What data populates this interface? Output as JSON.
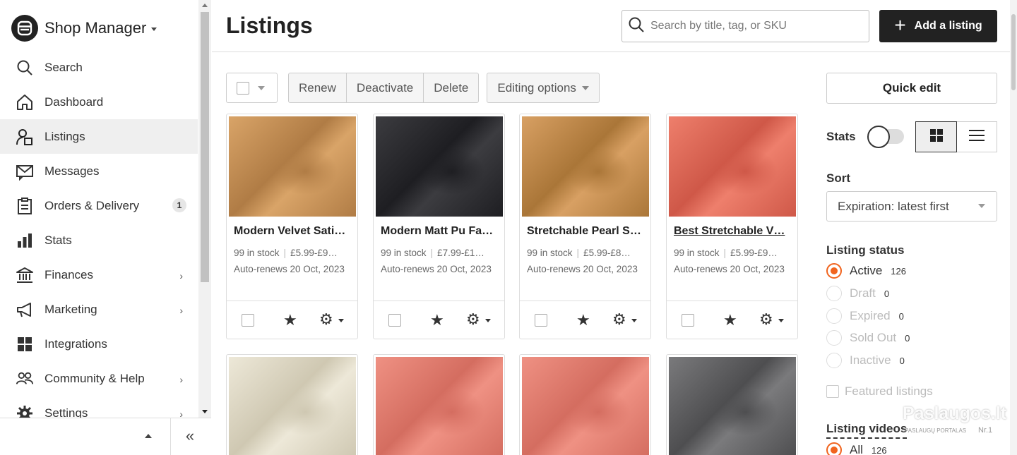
{
  "sidebar": {
    "shop_title": "Shop Manager",
    "items": [
      {
        "label": "Search",
        "icon": "search-icon"
      },
      {
        "label": "Dashboard",
        "icon": "home-icon"
      },
      {
        "label": "Listings",
        "icon": "listings-icon",
        "active": true
      },
      {
        "label": "Messages",
        "icon": "envelope-icon"
      },
      {
        "label": "Orders & Delivery",
        "icon": "clipboard-icon",
        "badge": "1"
      },
      {
        "label": "Stats",
        "icon": "bar-chart-icon"
      },
      {
        "label": "Finances",
        "icon": "bank-icon",
        "has_submenu": true
      },
      {
        "label": "Marketing",
        "icon": "megaphone-icon",
        "has_submenu": true
      },
      {
        "label": "Integrations",
        "icon": "grid-icon"
      },
      {
        "label": "Community & Help",
        "icon": "people-icon",
        "has_submenu": true
      },
      {
        "label": "Settings",
        "icon": "gear-icon",
        "has_submenu": true
      }
    ],
    "collapse_glyph": "«"
  },
  "header": {
    "title": "Listings",
    "search_placeholder": "Search by title, tag, or SKU",
    "add_button": "Add a listing",
    "add_glyph": "+"
  },
  "toolbar": {
    "renew": "Renew",
    "deactivate": "Deactivate",
    "delete": "Delete",
    "editing_options": "Editing options"
  },
  "listings": [
    {
      "title": "Modern Velvet Sati…",
      "stock": "99 in stock",
      "price": "£5.99-£9…",
      "renew": "Auto-renews 20 Oct, 2023",
      "color": "#d9a468",
      "shade": "#b07c45"
    },
    {
      "title": "Modern Matt Pu Fa…",
      "stock": "99 in stock",
      "price": "£7.99-£1…",
      "renew": "Auto-renews 20 Oct, 2023",
      "color": "#3c3c40",
      "shade": "#1e1e22"
    },
    {
      "title": "Stretchable Pearl S…",
      "stock": "99 in stock",
      "price": "£5.99-£8…",
      "renew": "Auto-renews 20 Oct, 2023",
      "color": "#d8a063",
      "shade": "#aa7638"
    },
    {
      "title": "Best Stretchable V…",
      "stock": "99 in stock",
      "price": "£5.99-£9…",
      "renew": "Auto-renews 20 Oct, 2023",
      "color": "#ee7f6c",
      "shade": "#cf5848",
      "underline": true
    },
    {
      "title": "",
      "stock": "",
      "price": "",
      "renew": "",
      "color": "#ede8d8",
      "shade": "#cfc8b2"
    },
    {
      "title": "",
      "stock": "",
      "price": "",
      "renew": "",
      "color": "#ef9183",
      "shade": "#d46d60"
    },
    {
      "title": "",
      "stock": "",
      "price": "",
      "renew": "",
      "color": "#ef9183",
      "shade": "#d46d60"
    },
    {
      "title": "",
      "stock": "",
      "price": "",
      "renew": "",
      "color": "#7a7a7c",
      "shade": "#4e4e50"
    }
  ],
  "meta_separator": "|",
  "right_panel": {
    "quick_edit": "Quick edit",
    "stats_label": "Stats",
    "sort_label": "Sort",
    "sort_value": "Expiration: latest first",
    "status_label": "Listing status",
    "statuses": [
      {
        "label": "Active",
        "count": "126",
        "selected": true
      },
      {
        "label": "Draft",
        "count": "0"
      },
      {
        "label": "Expired",
        "count": "0"
      },
      {
        "label": "Sold Out",
        "count": "0"
      },
      {
        "label": "Inactive",
        "count": "0"
      }
    ],
    "featured_label": "Featured listings",
    "videos_label": "Listing videos",
    "videos_all": {
      "label": "All",
      "count": "126"
    }
  },
  "watermark": {
    "main": "Paslaugos.lt",
    "sub": "PASLAUGŲ PORTALAS",
    "nr": "Nr.1"
  },
  "colors": {
    "accent": "#f1641e",
    "dark": "#222222"
  }
}
